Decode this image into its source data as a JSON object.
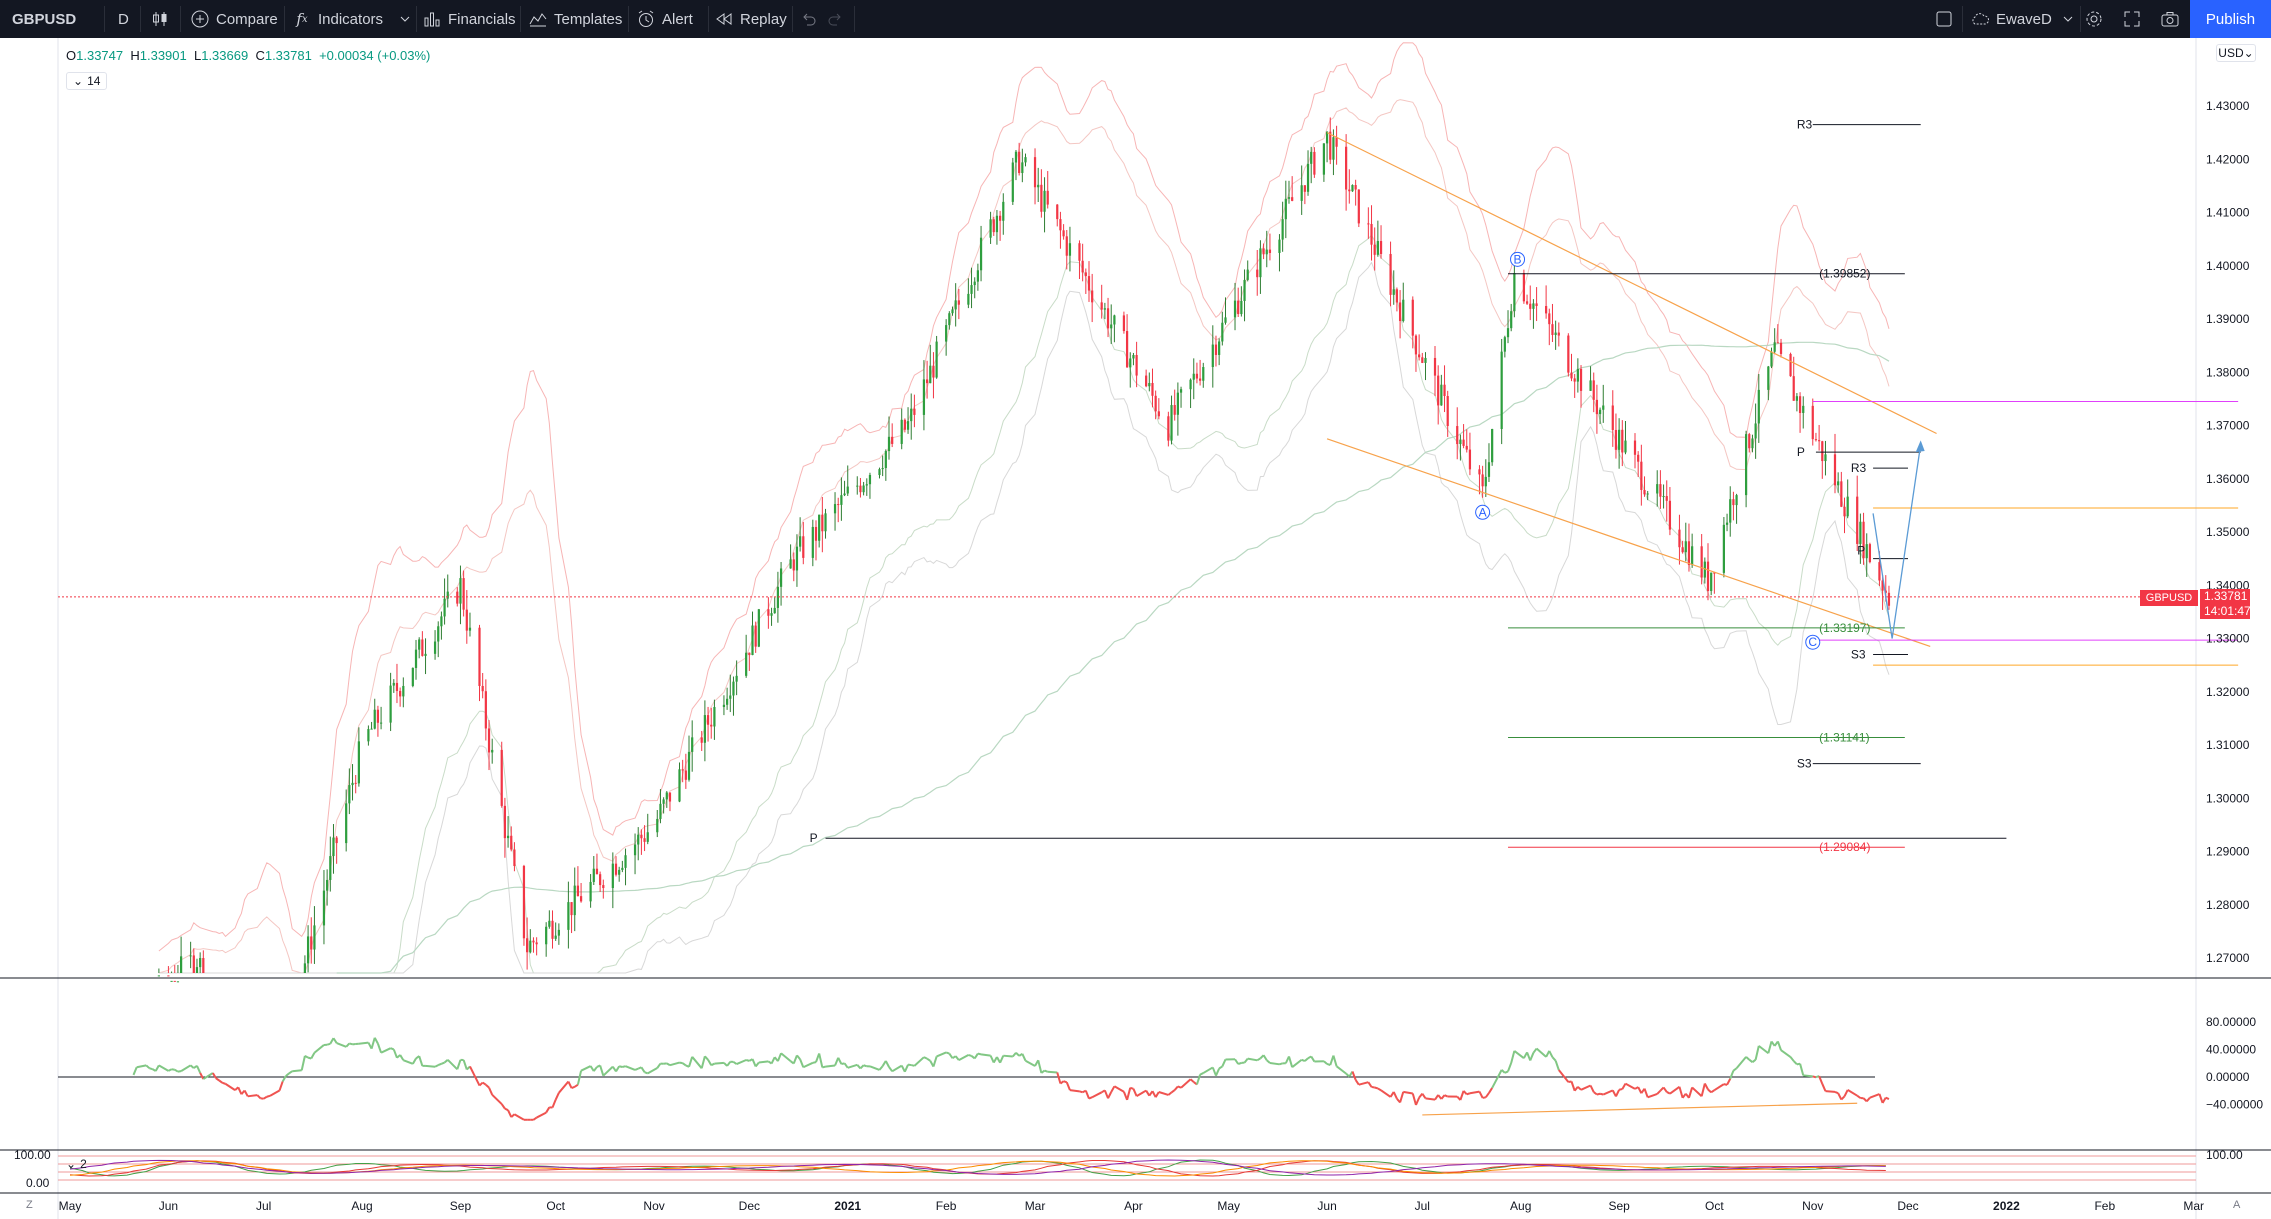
{
  "toolbar": {
    "symbol": "GBPUSD",
    "interval": "D",
    "compare_label": "Compare",
    "indicators_label": "Indicators",
    "financials_label": "Financials",
    "templates_label": "Templates",
    "alert_label": "Alert",
    "replay_label": "Replay",
    "layout_name": "EwaveD",
    "publish_label": "Publish"
  },
  "legend": {
    "open_label": "O",
    "open": "1.33747",
    "high_label": "H",
    "high": "1.33901",
    "low_label": "L",
    "low": "1.33669",
    "close_label": "C",
    "close": "1.33781",
    "change": "+0.00034 (+0.03%)",
    "indicator_badge": "14",
    "lower_badge": "2"
  },
  "price_axis": {
    "currency": "USD",
    "ticks": [
      "1.43000",
      "1.42000",
      "1.41000",
      "1.40000",
      "1.39000",
      "1.38000",
      "1.37000",
      "1.36000",
      "1.35000",
      "1.34000",
      "1.33000",
      "1.32000",
      "1.31000",
      "1.30000",
      "1.29000",
      "1.28000",
      "1.27000"
    ],
    "last_price": "1.33781",
    "countdown": "14:01:47",
    "symbol_tag": "GBPUSD"
  },
  "oscillator_axis": {
    "ticks": [
      "80.00000",
      "40.00000",
      "0.00000",
      "−40.00000"
    ]
  },
  "lower_axis": {
    "ticks": [
      "100.00",
      "0.00"
    ],
    "right_tick": "100.00"
  },
  "time_axis": {
    "labels": [
      "May",
      "Jun",
      "Jul",
      "Aug",
      "Sep",
      "Oct",
      "Nov",
      "Dec",
      "2021",
      "Feb",
      "Mar",
      "Apr",
      "May",
      "Jun",
      "Jul",
      "Aug",
      "Sep",
      "Oct",
      "Nov",
      "Dec",
      "2022",
      "Feb",
      "Mar"
    ]
  },
  "annotations": {
    "wave_a": "A",
    "wave_b": "B",
    "wave_c": "C",
    "level_1": "(1.39852)",
    "level_2": "(1.33197)",
    "level_3": "(1.31141)",
    "level_4": "(1.29084)",
    "pivot_r3_top": "R3",
    "pivot_r3_mid": "R3",
    "pivot_p_mid": "P",
    "pivot_s3_mid": "S3",
    "pivot_s3_low": "S3",
    "pivot_p_low": "P",
    "pivot_p_small": "P"
  },
  "corner": {
    "left_button": "Z",
    "right_button": "A"
  },
  "colors": {
    "up_candle": "#089981",
    "up_wick": "#2e7d32",
    "down_candle": "#f23645",
    "wedge_line": "#f7a24b",
    "projection": "#5b9bd5",
    "magenta_level": "#e040fb",
    "orange_level": "#ffa726"
  },
  "chart_data": {
    "type": "candlestick",
    "symbol": "GBPUSD",
    "timeframe": "D",
    "ylim": [
      1.265,
      1.435
    ],
    "approx_closes": [
      {
        "date": "2020-05-01",
        "value": 1.25
      },
      {
        "date": "2020-06-10",
        "value": 1.27
      },
      {
        "date": "2020-07-01",
        "value": 1.24
      },
      {
        "date": "2020-08-01",
        "value": 1.31
      },
      {
        "date": "2020-09-01",
        "value": 1.34
      },
      {
        "date": "2020-09-22",
        "value": 1.272
      },
      {
        "date": "2020-11-01",
        "value": 1.295
      },
      {
        "date": "2020-12-15",
        "value": 1.345
      },
      {
        "date": "2021-01-20",
        "value": 1.37
      },
      {
        "date": "2021-02-24",
        "value": 1.42
      },
      {
        "date": "2021-04-12",
        "value": 1.37
      },
      {
        "date": "2021-06-01",
        "value": 1.424
      },
      {
        "date": "2021-07-20",
        "value": 1.357
      },
      {
        "date": "2021-07-30",
        "value": 1.3985
      },
      {
        "date": "2021-09-29",
        "value": 1.341
      },
      {
        "date": "2021-10-20",
        "value": 1.384
      },
      {
        "date": "2021-11-25",
        "value": 1.3378
      }
    ]
  }
}
